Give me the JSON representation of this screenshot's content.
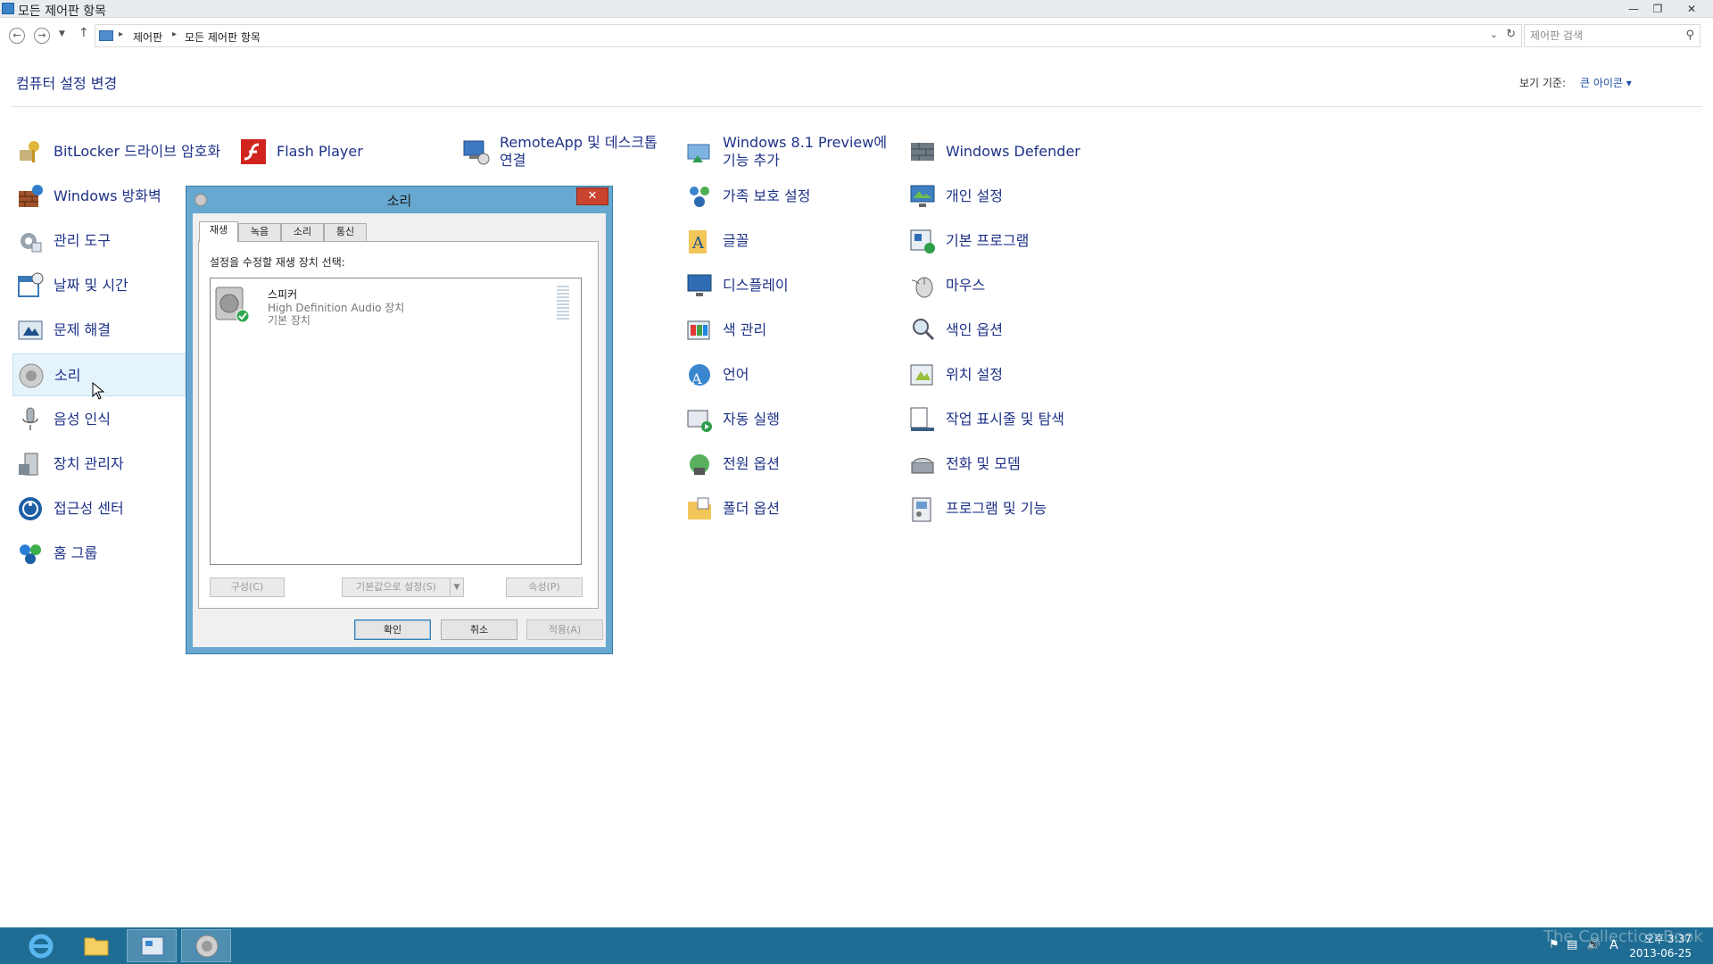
{
  "window": {
    "title": "모든 제어판 항목"
  },
  "address": {
    "crumbs": [
      "제어판",
      "모든 제어판 항목"
    ]
  },
  "search": {
    "placeholder": "제어판 검색"
  },
  "header": {
    "heading": "컴퓨터 설정 변경",
    "view_by_label": "보기 기준:",
    "view_by_value": "큰 아이콘 ▾"
  },
  "items": {
    "bitlocker": "BitLocker 드라이브 암호화",
    "flash": "Flash Player",
    "remoteapp": "RemoteApp 및 데스크톱 연결",
    "win81": "Windows 8.1 Preview에 기능 추가",
    "defender": "Windows Defender",
    "firewall": "Windows 방화벽",
    "family": "가족 보호 설정",
    "personal": "개인 설정",
    "admintools": "관리 도구",
    "fonts": "글꼴",
    "defaultprog": "기본 프로그램",
    "datetime": "날짜 및 시간",
    "display": "디스플레이",
    "mouse": "마우스",
    "troubleshoot": "문제 해결",
    "color": "색 관리",
    "indexing": "색인 옵션",
    "sound": "소리",
    "language": "언어",
    "location": "위치 설정",
    "speech": "음성 인식",
    "autoplay": "자동 실행",
    "taskbar": "작업 표시줄 및 탐색",
    "devmgr": "장치 관리자",
    "power": "전원 옵션",
    "phone": "전화 및 모뎀",
    "access": "접근성 센터",
    "folder": "폴더 옵션",
    "programs": "프로그램 및 기능",
    "homegroup": "홈 그룹"
  },
  "dialog": {
    "title": "소리",
    "tabs": [
      "재생",
      "녹음",
      "소리",
      "통신"
    ],
    "instruction": "설정을 수정할 재생 장치 선택:",
    "device": {
      "name": "스피커",
      "driver": "High Definition Audio 장치",
      "status": "기본 장치"
    },
    "configure": "구성(C)",
    "set_default": "기본값으로 설정(S)",
    "properties": "속성(P)",
    "ok": "확인",
    "cancel": "취소",
    "apply": "적용(A)"
  },
  "tray": {
    "time": "오후 3:37",
    "date": "2013-06-25",
    "ime": "A"
  },
  "watermark": "The Collection Book",
  "colors": {
    "link": "#1e3287",
    "taskbar": "#1f6d94",
    "dialog_frame": "#67a8d0"
  }
}
